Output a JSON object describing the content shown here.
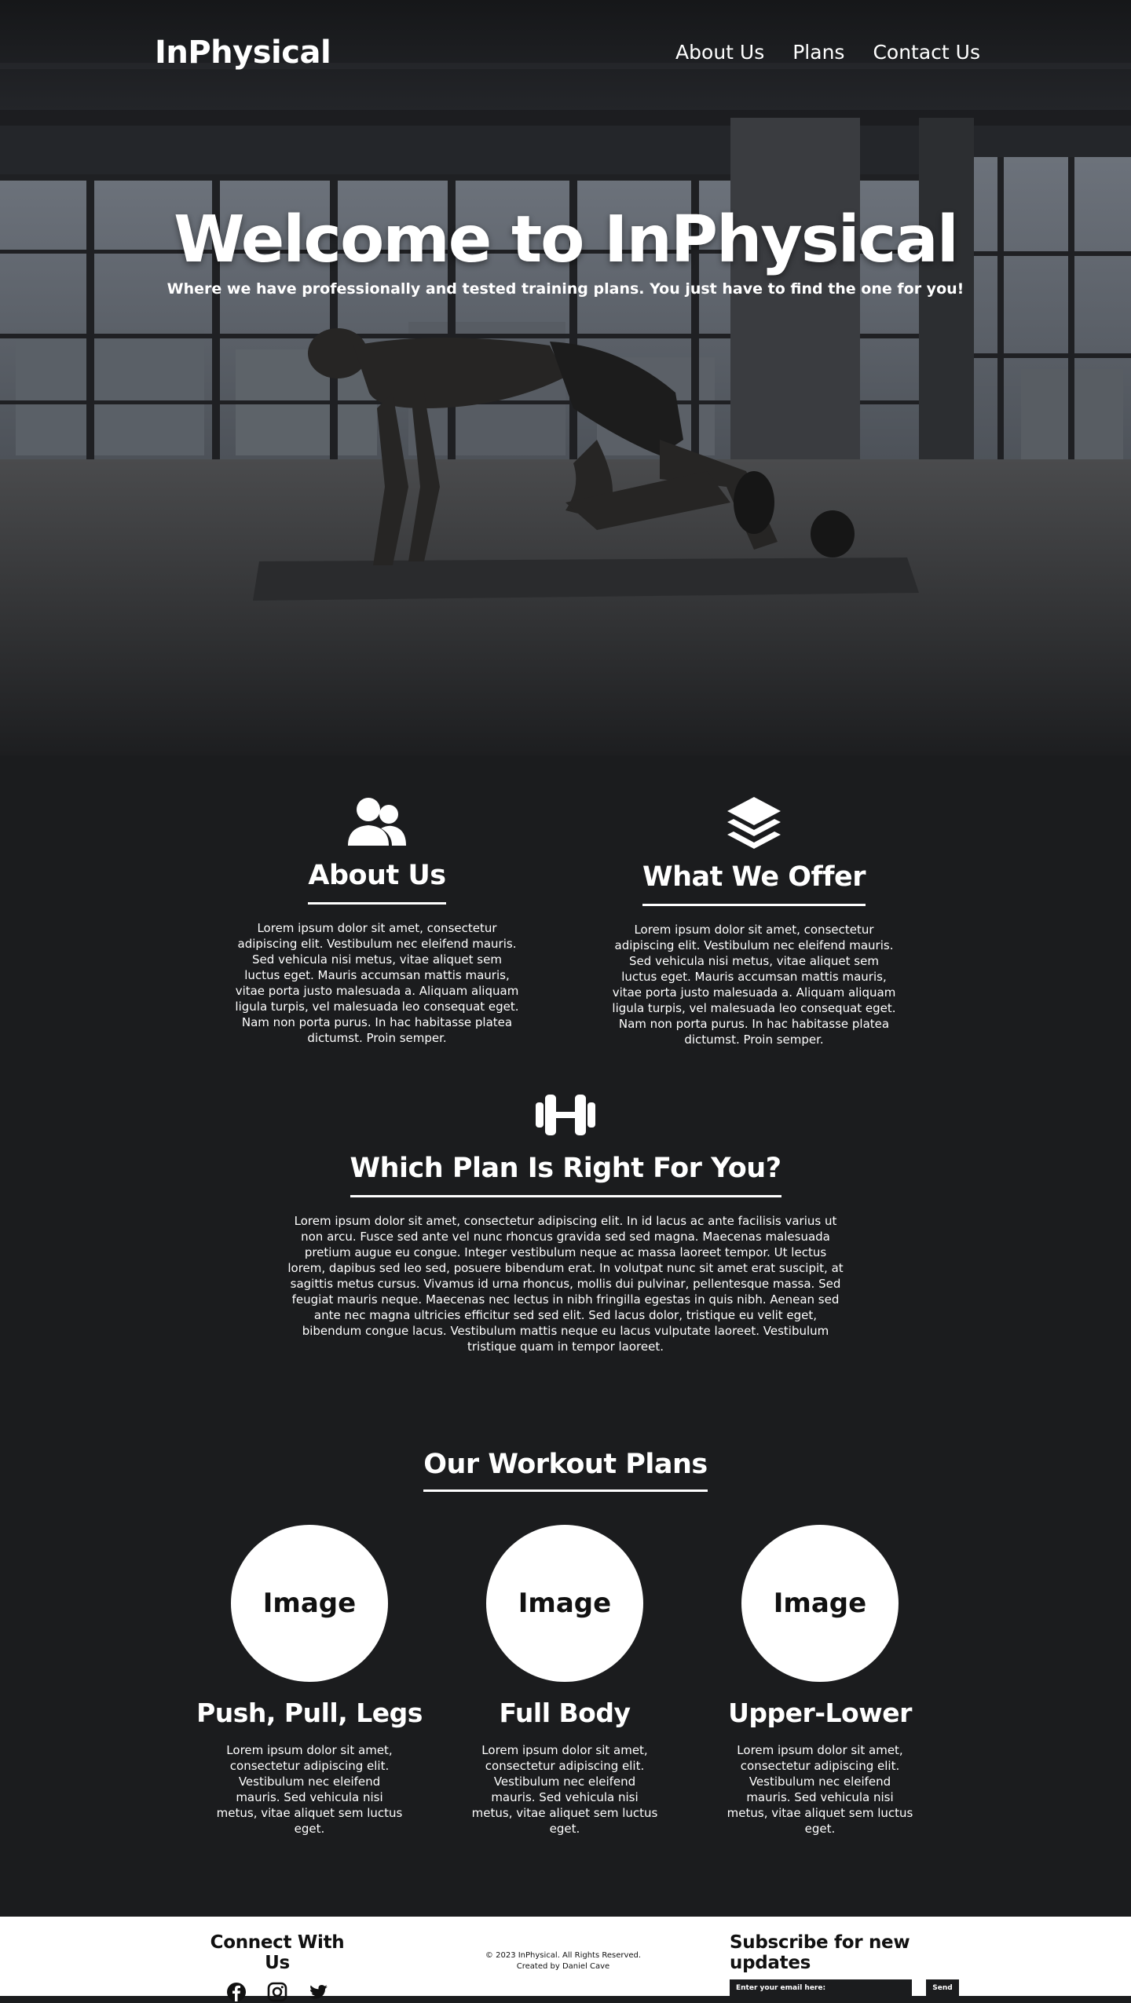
{
  "nav": {
    "brand": "InPhysical",
    "links": [
      "About Us",
      "Plans",
      "Contact Us"
    ]
  },
  "hero": {
    "title": "Welcome to InPhysical",
    "subtitle": "Where we have professionally and tested training plans. You just have to find the one for you!"
  },
  "features": [
    {
      "icon": "users-icon",
      "title": "About Us",
      "text": "Lorem ipsum dolor sit amet, consectetur adipiscing elit. Vestibulum nec eleifend mauris. Sed vehicula nisi metus, vitae aliquet sem luctus eget. Mauris accumsan mattis mauris, vitae porta justo malesuada a. Aliquam aliquam ligula turpis, vel malesuada leo consequat eget. Nam non porta purus. In hac habitasse platea dictumst. Proin semper."
    },
    {
      "icon": "layers-icon",
      "title": "What We Offer",
      "text": "Lorem ipsum dolor sit amet, consectetur adipiscing elit. Vestibulum nec eleifend mauris. Sed vehicula nisi metus, vitae aliquet sem luctus eget. Mauris accumsan mattis mauris, vitae porta justo malesuada a. Aliquam aliquam ligula turpis, vel malesuada leo consequat eget. Nam non porta purus. In hac habitasse platea dictumst. Proin semper."
    },
    {
      "icon": "dumbbell-icon",
      "title": "Which Plan Is Right For You?",
      "text": "Lorem ipsum dolor sit amet, consectetur adipiscing elit. In id lacus ac ante facilisis varius ut non arcu. Fusce sed ante vel nunc rhoncus gravida sed sed magna. Maecenas malesuada pretium augue eu congue. Integer vestibulum neque ac massa laoreet tempor. Ut lectus lorem, dapibus sed leo sed, posuere bibendum erat. In volutpat nunc sit amet erat suscipit, at sagittis metus cursus. Vivamus id urna rhoncus, mollis dui pulvinar, pellentesque massa. Sed feugiat mauris neque. Maecenas nec lectus in nibh fringilla egestas in quis nibh. Aenean sed ante nec magna ultricies efficitur sed sed elit. Sed lacus dolor, tristique eu velit eget, bibendum congue lacus. Vestibulum mattis neque eu lacus vulputate laoreet. Vestibulum tristique quam in tempor laoreet."
    }
  ],
  "plans": {
    "title": "Our Workout Plans",
    "items": [
      {
        "image_label": "Image",
        "name": "Push, Pull, Legs",
        "text": "Lorem ipsum dolor sit amet, consectetur adipiscing elit. Vestibulum nec eleifend mauris. Sed vehicula nisi metus, vitae aliquet sem luctus eget."
      },
      {
        "image_label": "Image",
        "name": "Full Body",
        "text": "Lorem ipsum dolor sit amet, consectetur adipiscing elit. Vestibulum nec eleifend mauris. Sed vehicula nisi metus, vitae aliquet sem luctus eget."
      },
      {
        "image_label": "Image",
        "name": "Upper-Lower",
        "text": "Lorem ipsum dolor sit amet, consectetur adipiscing elit. Vestibulum nec eleifend mauris. Sed vehicula nisi metus, vitae aliquet sem luctus eget."
      }
    ]
  },
  "footer": {
    "connect_title": "Connect With Us",
    "socials": [
      "facebook-icon",
      "instagram-icon",
      "twitter-icon"
    ],
    "copyright": "© 2023 InPhysical. All Rights Reserved.",
    "credit": "Created by Daniel Cave",
    "subscribe_title": "Subscribe for new updates",
    "email_placeholder": "Enter your email here:",
    "send_label": "Send"
  },
  "colors": {
    "background": "#1b1c1e",
    "text": "#ffffff",
    "footer_background": "#ffffff"
  }
}
